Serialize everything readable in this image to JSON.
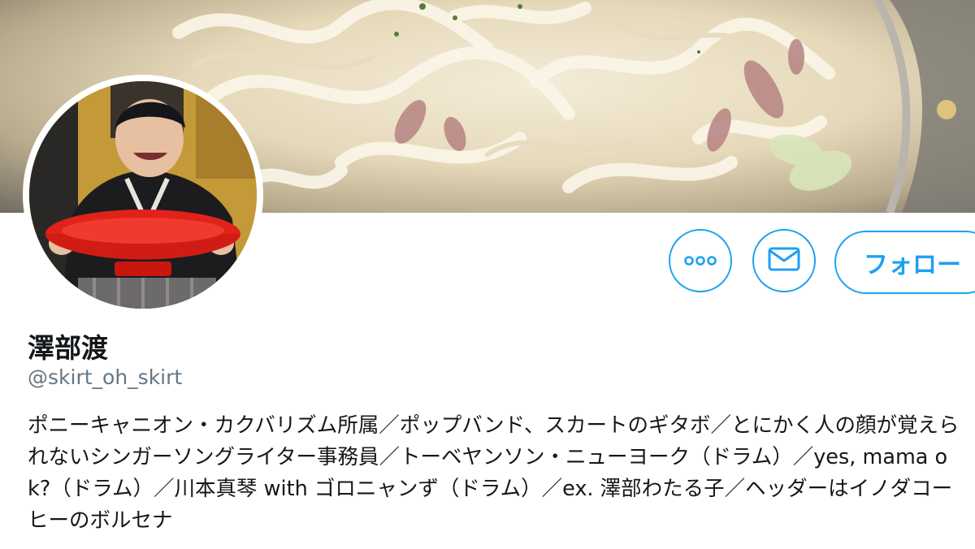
{
  "profile": {
    "display_name": "澤部渡",
    "handle": "@skirt_oh_skirt",
    "bio": "ポニーキャニオン・カクバリズム所属／ポップバンド、スカートのギタボ／とにかく人の顔が覚えられないシンガーソングライター事務員／トーベヤンソン・ニューヨーク（ドラム）／yes, mama ok?（ドラム）／川本真琴 with ゴロニャンず（ドラム）／ex. 澤部わたる子／ヘッダーはイノダコーヒーのボルセナ"
  },
  "actions": {
    "more_icon": "more-icon",
    "message_icon": "envelope-icon",
    "follow_label": "フォロー"
  },
  "colors": {
    "accent": "#1da1f2",
    "handle": "#657786",
    "text": "#14171a"
  }
}
